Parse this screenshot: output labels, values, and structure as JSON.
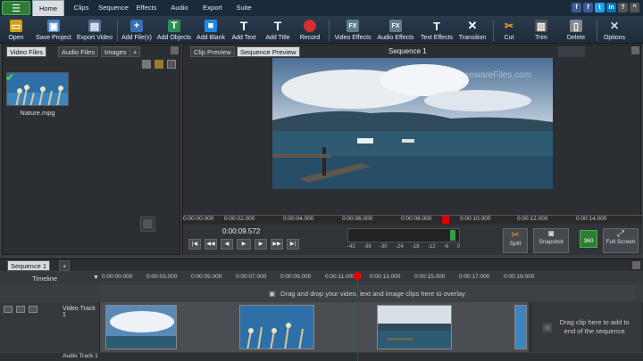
{
  "menu": {
    "tabs": [
      "Home",
      "Clips",
      "Sequence",
      "Effects",
      "Audio",
      "Export",
      "Suite"
    ]
  },
  "toolbar": {
    "buttons": [
      "Open",
      "Save Project",
      "Export Video",
      "Add File(s)",
      "Add Objects",
      "Add Blank",
      "Add Text",
      "Add Title",
      "Record",
      "Video Effects",
      "Audio Effects",
      "Text Effects",
      "Transition",
      "Cut",
      "Trim",
      "Delete",
      "Options"
    ]
  },
  "left_panel": {
    "tabs": [
      "Video Files",
      "Audio Files",
      "Images",
      "+"
    ],
    "file_name": "Nature.mpg"
  },
  "preview": {
    "tabs": [
      "Clip Preview",
      "Sequence Preview"
    ],
    "title": "Sequence 1",
    "watermark": "FreewareFiles.com",
    "ruler": [
      "0:00:00.000",
      "0:00:02.000",
      "0:00:04.000",
      "0:00:06.000",
      "0:00:08.000",
      "0:00:10.000",
      "0:00:12.000",
      "0:00:14.000"
    ],
    "current_time": "0:00:09.572",
    "meter_labels": [
      "-42",
      "-36",
      "-30",
      "-24",
      "-18",
      "-12",
      "-6",
      "0"
    ],
    "right_buttons": [
      "Split",
      "Snapshot",
      "360",
      "Full Screen"
    ]
  },
  "timeline": {
    "tab": "Sequence 1",
    "head_label": "Timeline",
    "ruler": [
      "0:00:00.000",
      "0:00:03.000",
      "0:00:05.000",
      "0:00:07.000",
      "0:00:09.000",
      "0:00:11.000",
      "0:00:13.000",
      "0:00:15.000",
      "0:00:17.000",
      "0:00:19.000"
    ],
    "overlay_text": "Drag and drop your video, text and image clips here to overlay",
    "video_track": "Video Track 1",
    "audio_track": "Audio Track 1",
    "drop_text": "Drag clip here to add to end of the sequence"
  },
  "colors": {
    "accent": "#2e7d32",
    "menubar": "#1b2a3a",
    "playhead": "#e00000"
  }
}
